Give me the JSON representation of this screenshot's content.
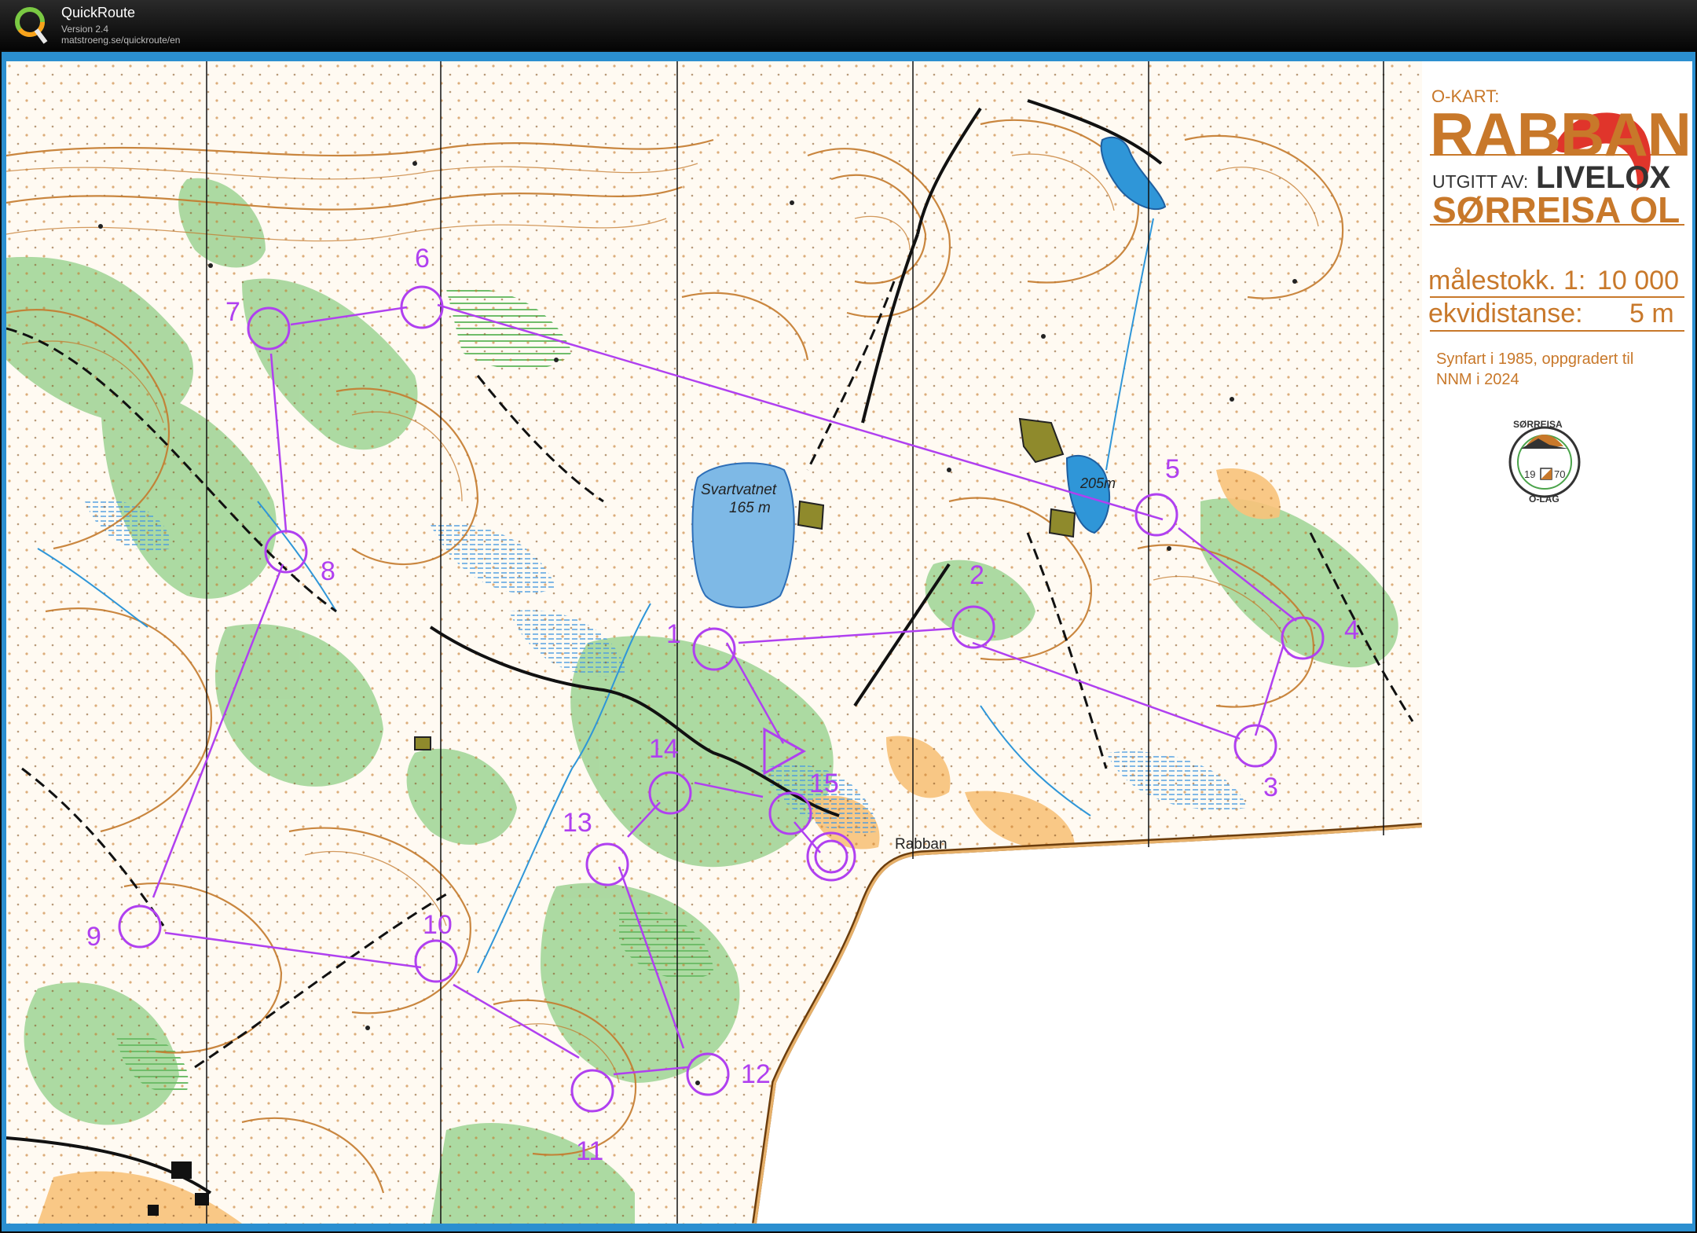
{
  "app": {
    "title": "QuickRoute",
    "version": "Version 2.4",
    "url": "matstroeng.se/quickroute/en"
  },
  "colors": {
    "frame": "#2b8fd0",
    "course": "#b040f0",
    "contour": "#c47a2c",
    "vegetation": "#7fc47a",
    "water": "#7eb9e6",
    "open_land": "#f6b95b"
  },
  "map_info": {
    "okart_label": "O-KART:",
    "map_name": "RABBAN",
    "publisher_label": "UTGITT AV:",
    "livelox": "LIVELOX",
    "club_name": "SØRREISA OL",
    "scale_label": "målestokk. 1:",
    "scale_value": "10 000",
    "contour_label": "ekvidistanse:",
    "contour_value": "5 m",
    "history_line1": "Synfart i 1985, oppgradert til",
    "history_line2": "NNM i 2024",
    "club_logo": {
      "top_text": "SØRREISA",
      "bottom_text": "O-LAG",
      "year_left": "19",
      "year_right": "70"
    }
  },
  "places": {
    "lake_name": "Svartvatnet",
    "lake_height": "165 m",
    "hill_height": "205m",
    "road_place": "Rabban"
  },
  "course": {
    "controls": [
      "1",
      "2",
      "3",
      "4",
      "5",
      "6",
      "7",
      "8",
      "9",
      "10",
      "11",
      "12",
      "13",
      "14",
      "15"
    ],
    "start_icon": "triangle-start",
    "finish_icon": "double-circle-finish"
  }
}
